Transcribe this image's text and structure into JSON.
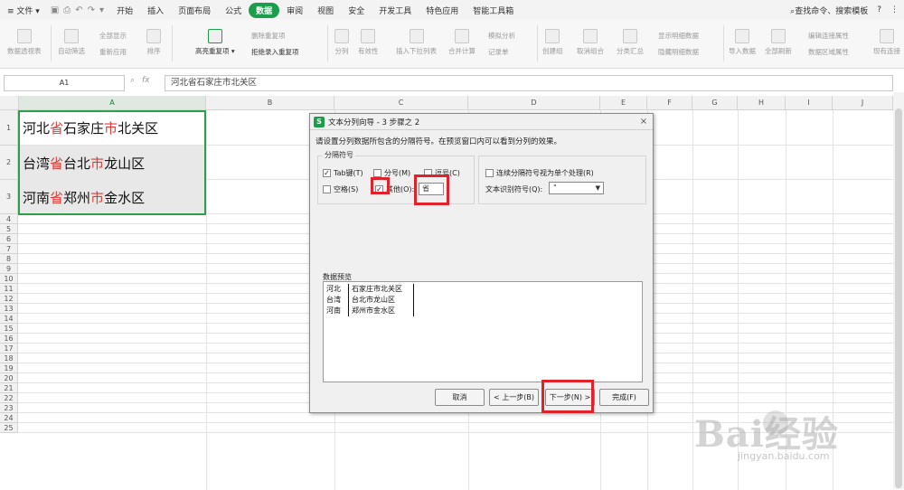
{
  "menubar": {
    "file_label": "文件",
    "items": [
      "开始",
      "插入",
      "页面布局",
      "公式",
      "数据",
      "审阅",
      "视图",
      "安全",
      "开发工具",
      "特色应用",
      "智能工具箱"
    ],
    "active_item": "数据",
    "search_label": "查找命令、搜索模板",
    "help_label": "?"
  },
  "ribbon": {
    "pivot": "数据透视表",
    "autofilter": "自动筛选",
    "show_all": "全部显示",
    "reapply": "重新应用",
    "sort": "排序",
    "highlight_dup": "高亮重复项",
    "remove_dup": "删除重复项",
    "reject_dup": "拒绝录入重复项",
    "split": "分列",
    "validity": "有效性",
    "dropdown": "插入下拉列表",
    "consolidate": "合并计算",
    "whatif": "模拟分析",
    "record": "记录单",
    "group": "创建组",
    "ungroup": "取消组合",
    "subtotal": "分类汇总",
    "show_detail": "显示明细数据",
    "hide_detail": "隐藏明细数据",
    "import": "导入数据",
    "refresh_all": "全部刷新",
    "edit_links": "编辑连接属性",
    "region_props": "数据区域属性",
    "existing": "现有连接"
  },
  "formula_bar": {
    "name_box": "A1",
    "fx_label": "fx",
    "value": "河北省石家庄市北关区"
  },
  "columns": [
    "A",
    "B",
    "C",
    "D",
    "E",
    "F",
    "G",
    "H",
    "I",
    "J"
  ],
  "rows": [
    "1",
    "2",
    "3",
    "4",
    "5",
    "6",
    "7",
    "8",
    "9",
    "10",
    "11",
    "12",
    "13",
    "14",
    "15",
    "16",
    "17",
    "18",
    "19",
    "20",
    "21",
    "22",
    "23",
    "24",
    "25"
  ],
  "cells": [
    {
      "a": "河北",
      "b": "省",
      "c": "石家庄",
      "d": "市",
      "e": "北关区"
    },
    {
      "a": "台湾",
      "b": "省",
      "c": "台北",
      "d": "市",
      "e": "龙山区"
    },
    {
      "a": "河南",
      "b": "省",
      "c": "郑州",
      "d": "市",
      "e": "金水区"
    }
  ],
  "dialog": {
    "title": "文本分列向导 - 3 步骤之 2",
    "close": "×",
    "description": "请设置分列数据所包含的分隔符号。在预览窗口内可以看到分列的效果。",
    "delimiter_group": "分隔符号",
    "tab": "Tab键(T)",
    "semicolon": "分号(M)",
    "comma": "逗号(C)",
    "space": "空格(S)",
    "other": "其他(O):",
    "other_value": "省",
    "consecutive": "连续分隔符号视为单个处理(R)",
    "qualifier_label": "文本识别符号(Q):",
    "qualifier_value": "\"",
    "preview_label": "数据预览",
    "preview_rows": [
      [
        "河北",
        "石家庄市北关区"
      ],
      [
        "台湾",
        "台北市龙山区"
      ],
      [
        "河南",
        "郑州市金水区"
      ]
    ],
    "cancel": "取消",
    "back": "< 上一步(B)",
    "next": "下一步(N) >",
    "finish": "完成(F)",
    "checked_mark": "✓"
  },
  "watermark": {
    "brand": "Bai经验",
    "sub": "jingyan.baidu.com"
  },
  "colors": {
    "accent": "#1b9e4b",
    "highlight": "#e1222a",
    "red_text": "#e53935"
  }
}
